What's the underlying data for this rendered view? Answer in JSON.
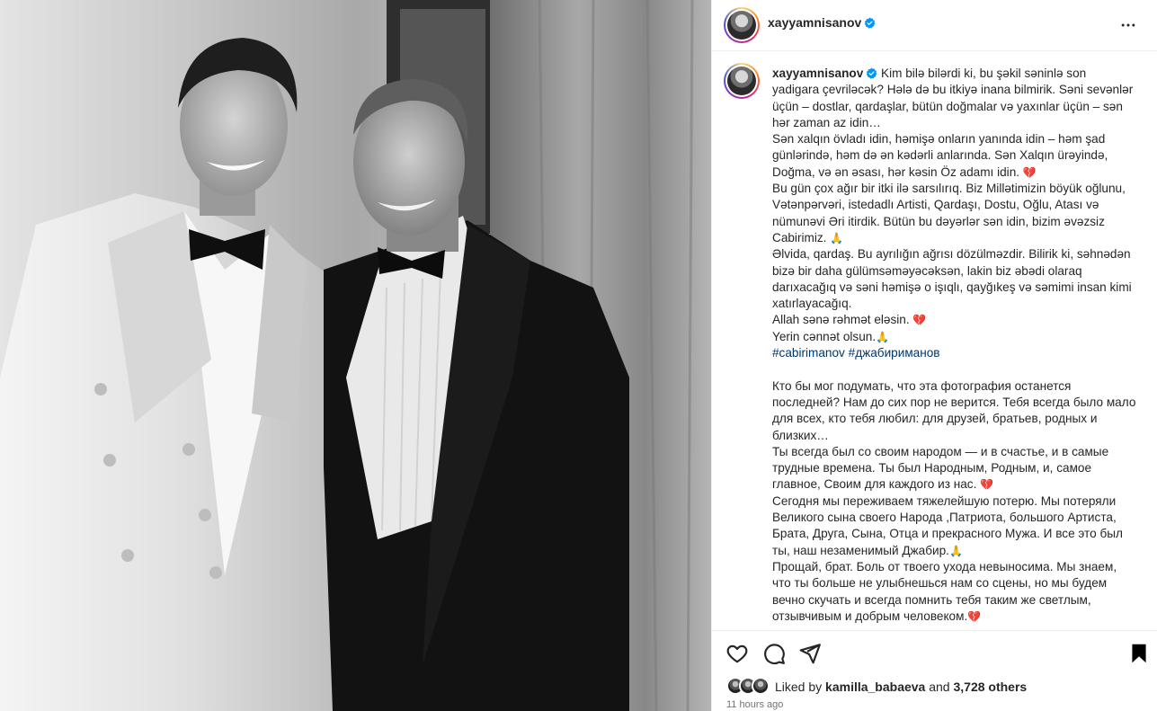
{
  "post": {
    "username": "xayyamnisanov",
    "caption": {
      "az": [
        "Kim bilə bilərdi ki, bu şəkil səninlə son yadigara çevriləcək? Hələ də bu itkiyə inana bilmirik. Səni sevənlər üçün – dostlar, qardaşlar, bütün doğmalar və yaxınlar üçün – sən hər zaman az idin…",
        "Sən xalqın övladı idin, həmişə onların yanında idin – həm şad günlərində, həm də ən kədərli anlarında. Sən Xalqın ürəyində, Doğma, və ən əsası, hər kəsin Öz adamı idin.",
        "Bu gün çox ağır bir itki ilə sarsılırıq. Biz Millətimizin böyük oğlunu, Vətənpərvəri, istedadlı Artisti, Qardaşı, Dostu, Oğlu, Atası və nümunəvi Əri itirdik. Bütün bu dəyərlər sən idin, bizim əvəzsiz Cabirimiz.",
        "Əlvida, qardaş. Bu ayrılığın ağrısı dözülməzdir. Bilirik ki, səhnədən bizə bir daha gülümsəməyəcəksən, lakin biz əbədi olaraq darıxacağıq və səni həmişə o işıqlı, qayğıkeş və səmimi insan kimi xatırlayacağıq.",
        "Allah sənə rəhmət eləsin.",
        "Yerin cənnət olsun."
      ],
      "hashtags": [
        "#cabirimanov",
        "#джабириманов"
      ],
      "ru": [
        "Кто бы мог подумать, что эта фотография останется последней? Нам до сих пор не верится. Тебя всегда было мало для всех, кто тебя любил: для друзей, братьев, родных и близких…",
        "Ты всегда был со своим народом — и в счастье, и в самые трудные времена. Ты был Народным, Родным, и, самое главное, Своим для каждого из нас.",
        "Сегодня мы переживаем тяжелейшую потерю. Мы потеряли Великого сына своего Народа ,Патриота, большого Артиста, Брата, Друга, Сына, Отца и прекрасного Мужа. И все это был ты, наш незаменимый Джабир.",
        "Прощай, брат. Боль от твоего ухода невыносима. Мы знаем, что ты больше не улыбнешься нам со сцены, но мы будем вечно скучать и всегда помнить тебя таким же светлым, отзывчивым и добрым человеком."
      ],
      "emoji": {
        "heart": "💔",
        "pray": "🙏"
      }
    },
    "likes": {
      "prefix": "Liked by",
      "user": "kamilla_babaeva",
      "joiner": "and",
      "others": "3,728 others"
    },
    "timestamp": "11 hours ago"
  },
  "icons": {
    "more": "more-horizontal-icon",
    "like": "heart-outline-icon",
    "comment": "comment-bubble-icon",
    "share": "paper-plane-icon",
    "save": "bookmark-filled-icon",
    "verified": "verified-badge-icon"
  },
  "colors": {
    "verified": "#0095f6",
    "hashtag": "#00376b",
    "timestamp": "#737373",
    "text": "#262626"
  }
}
